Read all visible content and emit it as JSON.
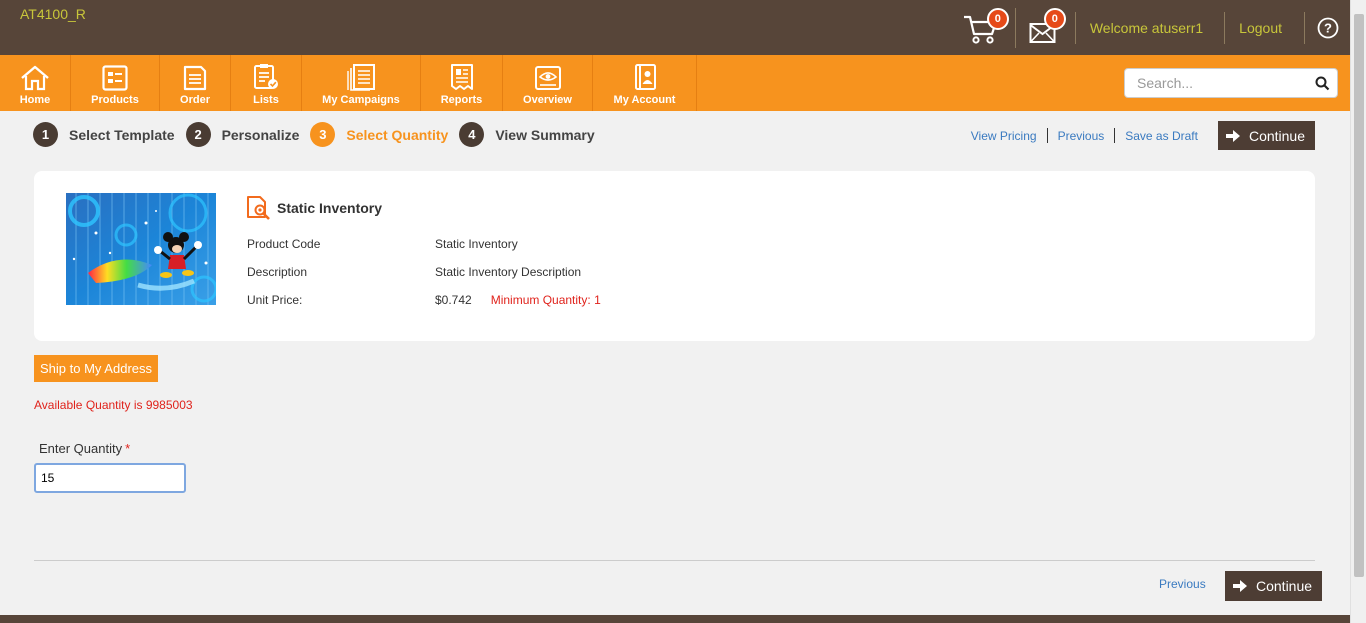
{
  "header": {
    "site_code": "AT4100_R",
    "cart_count": "0",
    "mail_count": "0",
    "welcome": "Welcome atuserr1",
    "logout": "Logout"
  },
  "nav": {
    "items": [
      {
        "label": "Home",
        "icon": "home-icon"
      },
      {
        "label": "Products",
        "icon": "products-icon"
      },
      {
        "label": "Order",
        "icon": "order-icon"
      },
      {
        "label": "Lists",
        "icon": "lists-icon"
      },
      {
        "label": "My Campaigns",
        "icon": "campaigns-icon"
      },
      {
        "label": "Reports",
        "icon": "reports-icon"
      },
      {
        "label": "Overview",
        "icon": "overview-icon"
      },
      {
        "label": "My Account",
        "icon": "account-icon"
      }
    ],
    "search_placeholder": "Search..."
  },
  "steps": {
    "items": [
      {
        "num": "1",
        "label": "Select Template"
      },
      {
        "num": "2",
        "label": "Personalize"
      },
      {
        "num": "3",
        "label": "Select Quantity"
      },
      {
        "num": "4",
        "label": "View Summary"
      }
    ],
    "active_index": 2,
    "view_pricing": "View Pricing",
    "previous": "Previous",
    "save_draft": "Save as Draft",
    "continue": "Continue"
  },
  "product": {
    "title": "Static Inventory",
    "rows": [
      {
        "key": "Product Code",
        "value": "Static Inventory"
      },
      {
        "key": "Description",
        "value": "Static Inventory Description"
      },
      {
        "key": "Unit Price:",
        "value": "$0.742"
      }
    ],
    "min_quantity": "Minimum Quantity: 1"
  },
  "form": {
    "ship_button": "Ship to My Address",
    "available": "Available Quantity is 9985003",
    "qty_label": "Enter Quantity",
    "required_mark": "*",
    "qty_value": "15"
  },
  "footer_actions": {
    "previous": "Previous",
    "continue": "Continue"
  },
  "colors": {
    "topbar": "#574539",
    "nav": "#f7931e",
    "accent_text": "#c8c63a",
    "error": "#e0231c",
    "link": "#3a7ac0"
  }
}
